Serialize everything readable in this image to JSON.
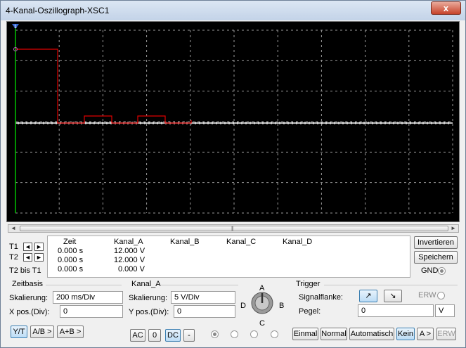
{
  "window": {
    "title": "4-Kanal-Oszillograph-XSC1",
    "close": "x"
  },
  "scope": {
    "background": "#000000",
    "grid_color": "#9a9a9a",
    "cursor1_color": "#00c000",
    "cursor1_label": "1",
    "trace_red": "#e00000",
    "trace_white": "#ffffff"
  },
  "scrollbar": {
    "left": "◄",
    "right": "►",
    "grip": "|||"
  },
  "cursors": {
    "t1": "T1",
    "t2": "T2",
    "t2t1": "T2 bis T1",
    "left_arrow": "◄",
    "right_arrow": "►"
  },
  "measurements": {
    "headers": [
      "Zeit",
      "Kanal_A",
      "Kanal_B",
      "Kanal_C",
      "Kanal_D"
    ],
    "rows": [
      [
        "0.000 s",
        "12.000 V",
        "",
        "",
        ""
      ],
      [
        "0.000 s",
        "12.000 V",
        "",
        "",
        ""
      ],
      [
        "0.000 s",
        "0.000 V",
        "",
        "",
        ""
      ]
    ]
  },
  "actions": {
    "invert": "Invertieren",
    "save": "Speichern",
    "gnd": "GND"
  },
  "timebase": {
    "title": "Zeitbasis",
    "scale_label": "Skalierung:",
    "scale_value": "200 ms/Div",
    "xpos_label": "X pos.(Div):",
    "xpos_value": "0",
    "modes": [
      "Y/T",
      "A/B >",
      "A+B >"
    ]
  },
  "channel": {
    "title": "Kanal_A",
    "scale_label": "Skalierung:",
    "scale_value": "5  V/Div",
    "ypos_label": "Y pos.(Div):",
    "ypos_value": "0",
    "coupling": [
      "AC",
      "0",
      "DC",
      "-"
    ],
    "knob_labels": {
      "a": "A",
      "b": "B",
      "c": "C",
      "d": "D"
    }
  },
  "trigger": {
    "title": "Trigger",
    "edge_label": "Signalflanke:",
    "edge_rising": "↗",
    "edge_falling": "↘",
    "erw": "ERW",
    "level_label": "Pegel:",
    "level_value": "0",
    "level_unit": "V",
    "modes": [
      "Einmal",
      "Normal",
      "Automatisch",
      "Kein",
      "A >",
      "ERW"
    ]
  }
}
